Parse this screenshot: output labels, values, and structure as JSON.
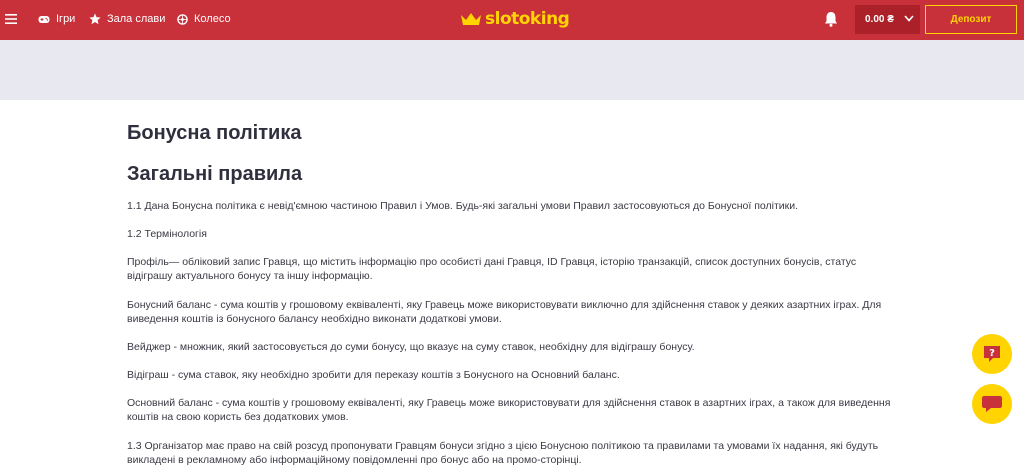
{
  "header": {
    "nav": [
      {
        "label": "Ігри",
        "icon": "gamepad-icon"
      },
      {
        "label": "Зала слави",
        "icon": "star-icon"
      },
      {
        "label": "Колесо",
        "icon": "wheel-icon"
      }
    ],
    "logo_text": "slotoking",
    "balance": "0.00 ₴",
    "deposit_label": "Депозит"
  },
  "content": {
    "title": "Бонусна політика",
    "section_title": "Загальні правила",
    "paragraphs": [
      "1.1 Дана Бонусна політика є невід'ємною частиною Правил і Умов. Будь-які загальні умови Правил застосовуються до Бонусної політики.",
      "1.2 Термінологія",
      "Профіль— обліковий запис Гравця, що містить інформацію про особисті дані Гравця, ID Гравця, історію транзакцій, список доступних бонусів, статус відіграшу актуального бонусу та іншу інформацію.",
      "Бонусний баланс - сума коштів у грошовому еквіваленті, яку Гравець може використовувати виключно для здійснення ставок у деяких азартних іграх. Для виведення коштів із бонусного балансу необхідно виконати додаткові умови.",
      "Вейджер - множник, який застосовується до суми бонусу, що вказує на суму ставок, необхідну для відіграшу бонусу.",
      "Відіграш - сума ставок, яку необхідно зробити для переказу коштів з Бонусного на Основний баланс.",
      "Основний баланс - сума коштів у грошовому еквіваленті, яку Гравець може використовувати для здійснення ставок в азартних іграх, а також для виведення коштів на свою користь без додаткових умов.",
      "1.3 Організатор має право на свій розсуд пропонувати Гравцям бонуси згідно з цією Бонусною політикою та правилами та умовами їх надання, які будуть викладені в рекламному або інформаційному повідомленні про бонус або на промо-сторінці."
    ]
  },
  "colors": {
    "header_red": "#c8303a",
    "accent_yellow": "#ffd400",
    "banner_gray": "#e8e9f0"
  }
}
